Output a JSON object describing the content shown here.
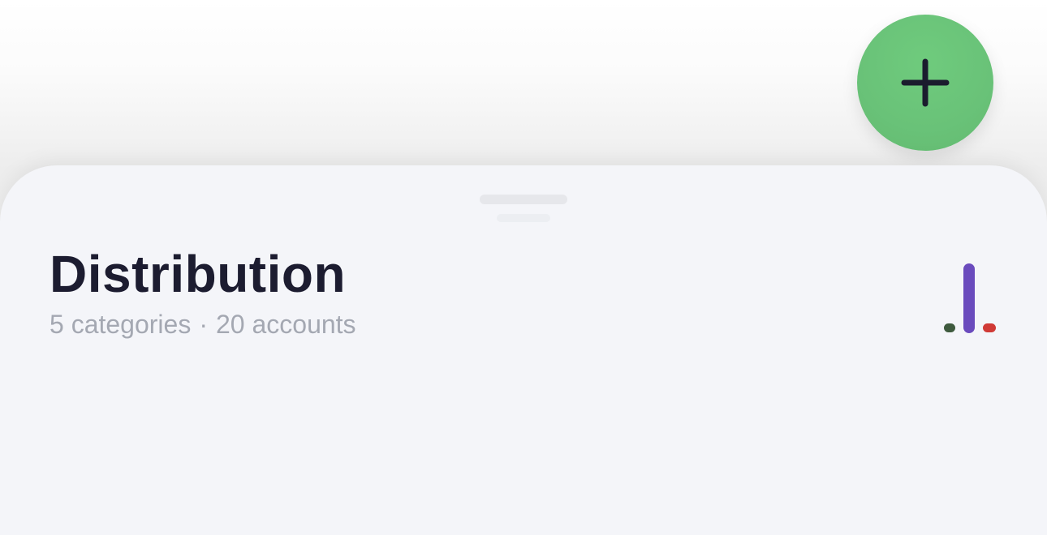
{
  "fab": {
    "icon": "plus-icon"
  },
  "sheet": {
    "title": "Distribution",
    "categories_text": "5 categories",
    "separator": "·",
    "accounts_text": "20 accounts"
  },
  "mini_chart": {
    "icon": "distribution-chart-icon",
    "colors": {
      "left": "#3e5a3e",
      "middle": "#6a4bbd",
      "right": "#d03a36"
    }
  }
}
